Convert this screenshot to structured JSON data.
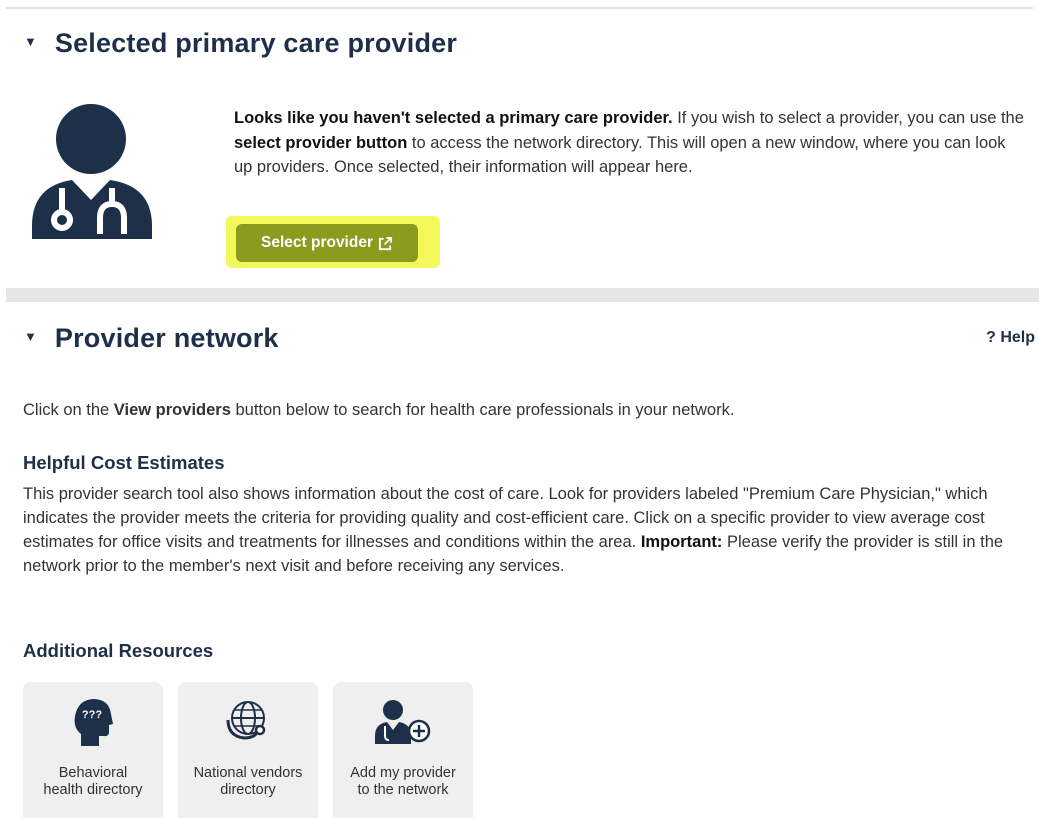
{
  "pcp_section": {
    "title": "Selected primary care provider",
    "message_bold": "Looks like you haven't selected a primary care provider.",
    "message_part1": " If you wish to select a provider, you can use the ",
    "message_button_ref": "select provider button",
    "message_part2": " to access the network directory. This will open a new window, where you can look up providers. Once selected, their information will appear here.",
    "select_button_label": "Select provider",
    "icon": "doctor-stethoscope-icon"
  },
  "network_section": {
    "title": "Provider network",
    "help_label": "? Help",
    "intro_prefix": "Click on the ",
    "intro_bold": "View providers",
    "intro_suffix": " button below to search for health care professionals in your network.",
    "cost_heading": "Helpful Cost Estimates",
    "cost_text": "This provider search tool also shows information about the cost of care. Look for providers labeled \"Premium Care Physician,\" which indicates the provider meets the criteria for providing quality and cost-efficient care. Click on a specific provider to view average cost estimates for office visits and treatments for illnesses and conditions within the area.",
    "important_label": "Important:",
    "important_text": " Please verify the provider is still in the network prior to the member's next visit and before receiving any services.",
    "resources_heading": "Additional Resources",
    "resources": [
      {
        "label_line1": "Behavioral",
        "label_line2": "health directory",
        "icon": "head-question-icon"
      },
      {
        "label_line1": "National vendors",
        "label_line2": "directory",
        "icon": "globe-stethoscope-icon"
      },
      {
        "label_line1": "Add my provider",
        "label_line2": "to the network",
        "icon": "add-doctor-icon"
      }
    ]
  },
  "colors": {
    "heading": "#1e2f4a",
    "button": "#8c9a1e",
    "highlight": "#f2f75a",
    "tile_bg": "#efefef"
  }
}
